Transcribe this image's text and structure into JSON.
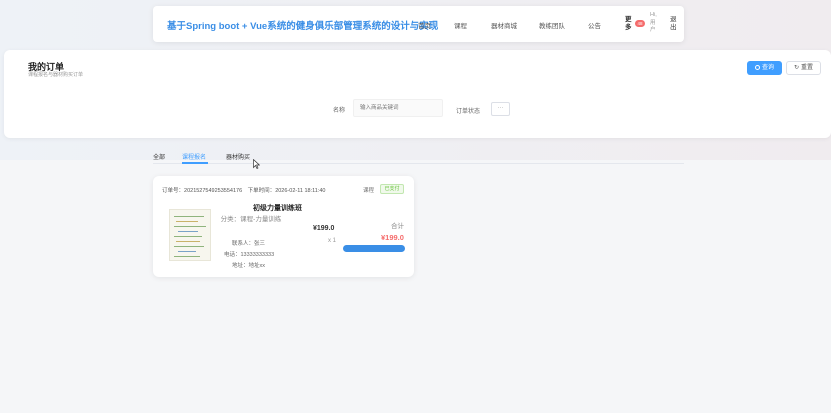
{
  "header": {
    "title": "基于Spring boot + Vue系统的健身俱乐部管理系统的设计与实现",
    "nav": [
      "首页",
      "课程",
      "器材商城",
      "教练团队",
      "公告"
    ],
    "more_label": "更多",
    "more_badge": "48",
    "user_label": "Hi,用户",
    "logout_label": "退出"
  },
  "panel": {
    "title": "我的订单",
    "subtitle": "课程报名与器材购买订单",
    "search_button": "查询",
    "reset_button": "重置",
    "name_label": "名称",
    "name_placeholder": "输入商品关键词",
    "status_label": "订单状态",
    "status_value": "···"
  },
  "tabs": {
    "items": [
      "全部",
      "课程报名",
      "器材购买"
    ],
    "active_index": 1
  },
  "order": {
    "order_no_label": "订单号：",
    "order_no": "2021527549253554176",
    "time_label": "下单时间：",
    "time": "2026-02-11 18:11:40",
    "type": "课程",
    "status_badge": "已支付",
    "product_name": "初级力量训练班",
    "category": "分类：课程-力量训练",
    "contact": "联系人：张三",
    "phone": "电话：13333333333",
    "address": "地址：地址xx",
    "price": "¥199.0",
    "quantity": "x 1",
    "total_label": "合计",
    "total": "¥199.0"
  },
  "colors": {
    "accent": "#409eff",
    "title_blue": "#3a8ee6",
    "price_red": "#f56c6c",
    "success_green": "#67c23a"
  }
}
